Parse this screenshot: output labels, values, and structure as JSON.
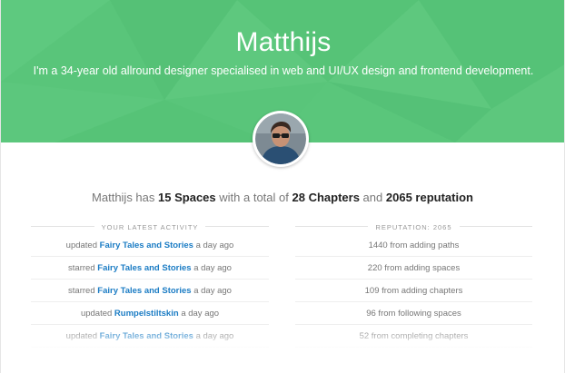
{
  "profile": {
    "name": "Matthijs",
    "bio": "I'm a 34-year old allround designer specialised in web and UI/UX design and frontend development."
  },
  "summary": {
    "prefix": "Matthijs has",
    "spaces": "15 Spaces",
    "middle": "with a total of",
    "chapters": "28 Chapters",
    "joiner": "and",
    "reputation": "2065 reputation"
  },
  "activity": {
    "header": "Your latest activity",
    "items": [
      {
        "verb": "updated",
        "target": "Fairy Tales and Stories",
        "time": "a day ago"
      },
      {
        "verb": "starred",
        "target": "Fairy Tales and Stories",
        "time": "a day ago"
      },
      {
        "verb": "starred",
        "target": "Fairy Tales and Stories",
        "time": "a day ago"
      },
      {
        "verb": "updated",
        "target": "Rumpelstiltskin",
        "time": "a day ago"
      },
      {
        "verb": "updated",
        "target": "Fairy Tales and Stories",
        "time": "a day ago"
      }
    ]
  },
  "reputation": {
    "header": "Reputation: 2065",
    "items": [
      "1440 from adding paths",
      "220 from adding spaces",
      "109 from adding chapters",
      "96 from following spaces",
      "52 from completing chapters"
    ]
  },
  "colors": {
    "hero": "#59c57a",
    "link": "#1b7cc4"
  }
}
